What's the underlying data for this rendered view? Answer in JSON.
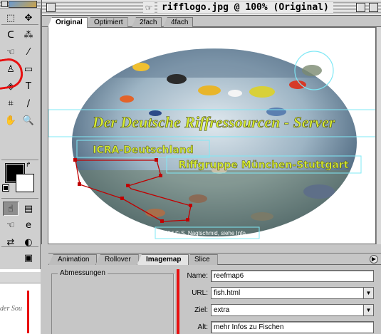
{
  "toolbox": {
    "tools": [
      {
        "name": "marquee-tool",
        "glyph": "⬚"
      },
      {
        "name": "move-tool",
        "glyph": "✥"
      },
      {
        "name": "lasso-tool",
        "glyph": "ᑕ"
      },
      {
        "name": "magic-wand-tool",
        "glyph": "⁂"
      },
      {
        "name": "hotspot-tool",
        "glyph": "☜"
      },
      {
        "name": "eyedropper-tool",
        "glyph": "⁄"
      },
      {
        "name": "rubber-stamp-tool",
        "glyph": "♙"
      },
      {
        "name": "eraser-tool",
        "glyph": "▭"
      },
      {
        "name": "paint-bucket-tool",
        "glyph": "◈"
      },
      {
        "name": "type-tool",
        "glyph": "T"
      },
      {
        "name": "crop-tool",
        "glyph": "⌗"
      },
      {
        "name": "color-picker-tool",
        "glyph": "∕"
      },
      {
        "name": "hand-tool",
        "glyph": "✋"
      },
      {
        "name": "zoom-tool",
        "glyph": "🔍"
      },
      {
        "name": "imagemap-hand-tool",
        "glyph": "☝"
      },
      {
        "name": "slice-select-tool",
        "glyph": "▤"
      },
      {
        "name": "preview-hand-tool",
        "glyph": "☜"
      },
      {
        "name": "browser-preview-tool",
        "glyph": "e"
      },
      {
        "name": "jump-to-app-tool",
        "glyph": "⇄"
      },
      {
        "name": "toggle-visibility-tool",
        "glyph": "◐"
      },
      {
        "name": "toggle-slices-tool",
        "glyph": "▣"
      }
    ],
    "desk_text": "der Sou"
  },
  "document": {
    "title": "rifflogo.jpg @ 100% (Original)",
    "tabs": [
      "Original",
      "Optimiert",
      "2fach",
      "4fach"
    ],
    "active_tab": "Original"
  },
  "image": {
    "headline": "Der Deutsche Riffressourcen - Server",
    "org": "ICRA-Deutschland",
    "group": "Riffgruppe München-Stuttgart",
    "credit": "Bild © S. Naglschmid, siehe Info..."
  },
  "panel": {
    "tabs": [
      "Animation",
      "Rollover",
      "Imagemap",
      "Slice"
    ],
    "active_tab": "Imagemap",
    "dims_label": "Abmessungen",
    "fields": {
      "name_label": "Name:",
      "name_value": "reefmap6",
      "url_label": "URL:",
      "url_value": "fish.html",
      "target_label": "Ziel:",
      "target_value": "extra",
      "alt_label": "Alt:",
      "alt_value": "mehr Infos zu Fischen"
    }
  },
  "colors": {
    "annotation_red": "#e81010",
    "hotspot_outline": "#7fe8f5",
    "polygon_hotspot": "#c00000",
    "headline_text": "#d8ee30"
  }
}
